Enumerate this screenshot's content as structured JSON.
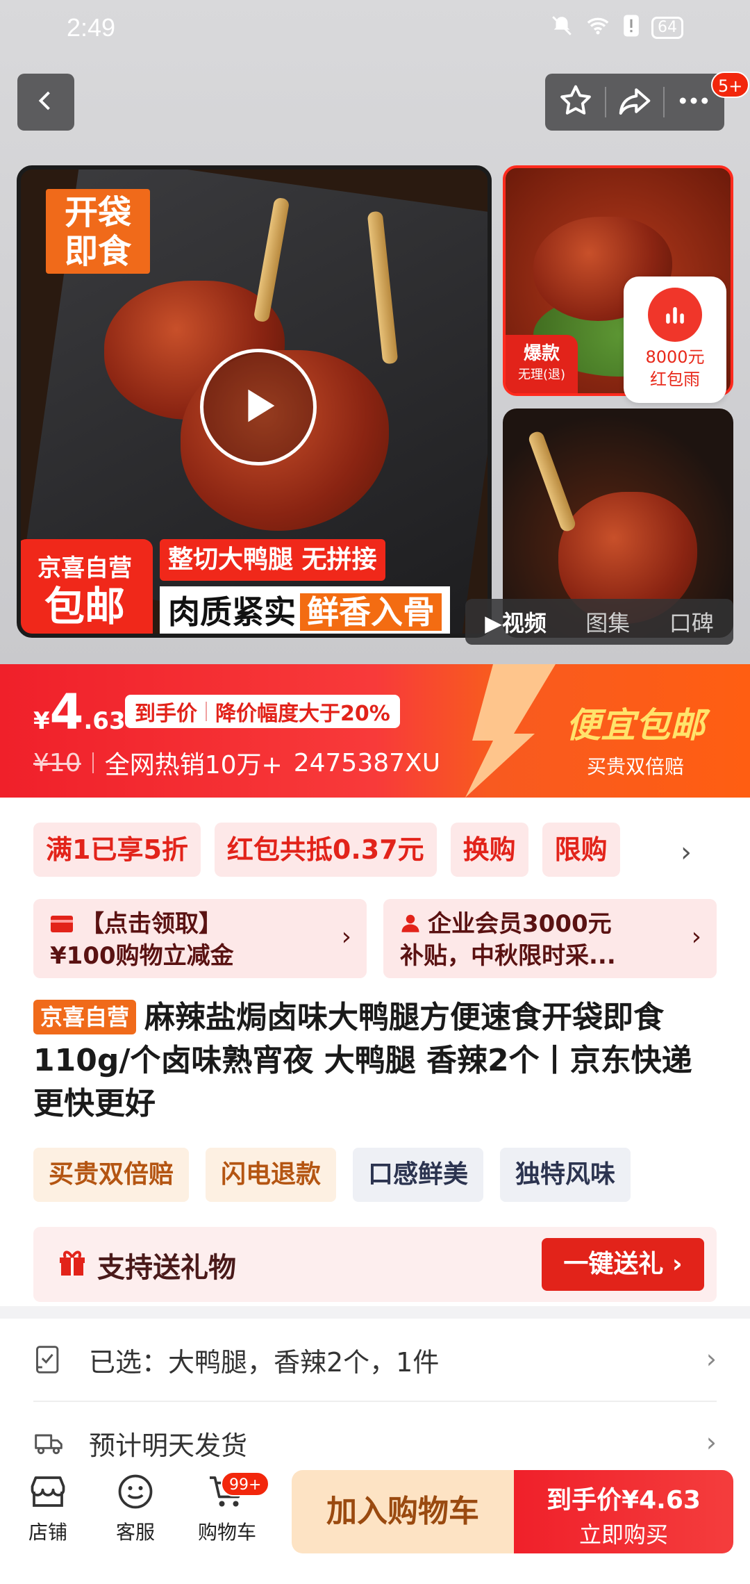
{
  "status_bar": {
    "time": "2:49",
    "battery": "64"
  },
  "header": {
    "badge": "5+"
  },
  "media": {
    "main_tag": "开袋\n即食",
    "jx_line1": "京喜自营",
    "jx_line2": "包邮",
    "cut_text": "整切大鸭腿 无拼接",
    "meat_text": "肉质紧实",
    "meat_highlight": "鲜香入骨",
    "side_tag": "爆款",
    "side_tag_sub": "无理(退)",
    "redrain_amount": "8000元",
    "redrain_label": "红包雨",
    "tabs": [
      {
        "label": "▶视频"
      },
      {
        "label": "图集"
      },
      {
        "label": "口碑"
      }
    ]
  },
  "price": {
    "yen": "¥",
    "integer": "4",
    "decimal": ".63",
    "tag1": "到手价",
    "tag2": "降价幅度大于20%",
    "old_price": "¥10",
    "sales": "全网热销10万+",
    "code": "2475387XU",
    "right_title": "便宜包邮",
    "right_sub": "买贵双倍赔"
  },
  "chips": [
    {
      "label": "满1已享5折"
    },
    {
      "label": "红包共抵0.37元"
    },
    {
      "label": "换购"
    },
    {
      "label": "限购"
    }
  ],
  "coupons": {
    "left_line1": "【点击领取】",
    "left_line2": "¥100购物立减金",
    "right_line1": "企业会员3000元",
    "right_line2": "补贴，中秋限时采..."
  },
  "product": {
    "store_tag": "京喜自营",
    "title": "麻辣盐焗卤味大鸭腿方便速食开袋即食110g/个卤味熟宵夜 大鸭腿 香辣2个丨京东快递 更快更好"
  },
  "feature_tags": [
    {
      "label": "买贵双倍赔"
    },
    {
      "label": "闪电退款"
    },
    {
      "label": "口感鲜美"
    },
    {
      "label": "独特风味"
    }
  ],
  "gift": {
    "label": "支持送礼物",
    "button": "一键送礼 ›"
  },
  "spec": {
    "selected": "已选：大鸭腿，香辣2个，1件",
    "shipping": "预计明天发货"
  },
  "bottom_bar": {
    "store": "店铺",
    "service": "客服",
    "cart": "购物车",
    "cart_badge": "99+",
    "add_cart": "加入购物车",
    "buy_line1": "到手价¥4.63",
    "buy_line2": "立即购买"
  },
  "colors": {
    "accent": "#e2231a",
    "orange": "#f06a1a"
  }
}
